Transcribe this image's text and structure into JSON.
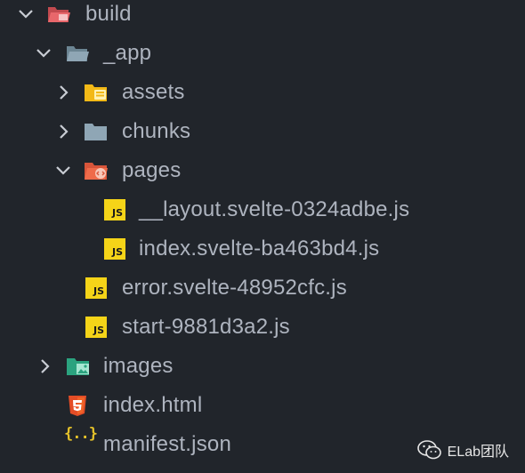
{
  "tree": {
    "build": "build",
    "app": "_app",
    "assets": "assets",
    "chunks": "chunks",
    "pages": "pages",
    "layout_file": "__layout.svelte-0324adbe.js",
    "index_svelte_file": "index.svelte-ba463bd4.js",
    "error_file": "error.svelte-48952cfc.js",
    "start_file": "start-9881d3a2.js",
    "images": "images",
    "index_html": "index.html",
    "manifest": "manifest.json"
  },
  "badges": {
    "js": "JS",
    "json": "{..}"
  },
  "watermark": {
    "text": "ELab团队"
  },
  "colors": {
    "background": "#21252b",
    "text": "#aeb4bf",
    "js_badge": "#f5d418",
    "build_folder": "#e8676b",
    "app_folder": "#8fa6b5",
    "assets_folder": "#f3b917",
    "chunks_folder": "#8fa6b5",
    "pages_folder": "#ef6b4a",
    "images_folder": "#2ba37f",
    "html5": "#e44d26",
    "json": "#e5c22a"
  },
  "icons": {
    "chevron_open": "chevron-down-icon",
    "chevron_closed": "chevron-right-icon"
  }
}
